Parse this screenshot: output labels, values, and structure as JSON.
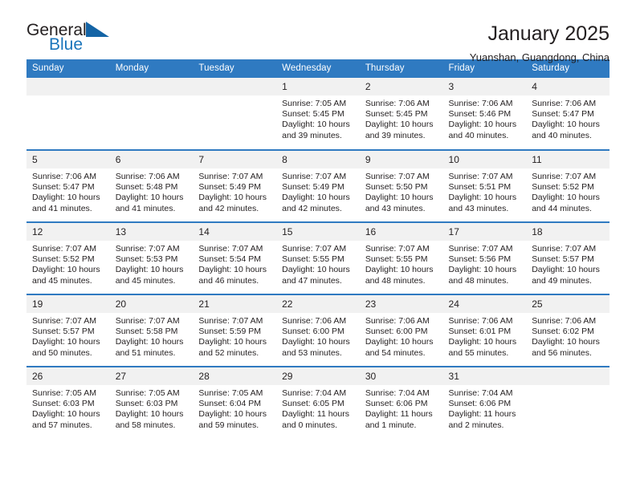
{
  "brand": {
    "name_part1": "General",
    "name_part2": "Blue",
    "triangle_icon": "triangle-icon",
    "accent_color": "#1b75bb"
  },
  "header": {
    "title": "January 2025",
    "subtitle": "Yuanshan, Guangdong, China"
  },
  "calendar": {
    "header_bg": "#2f7ac1",
    "daynum_bg": "#f1f1f1",
    "columns": [
      "Sunday",
      "Monday",
      "Tuesday",
      "Wednesday",
      "Thursday",
      "Friday",
      "Saturday"
    ],
    "weeks": [
      [
        {
          "day": "",
          "info": ""
        },
        {
          "day": "",
          "info": ""
        },
        {
          "day": "",
          "info": ""
        },
        {
          "day": "1",
          "info": "Sunrise: 7:05 AM\nSunset: 5:45 PM\nDaylight: 10 hours\nand 39 minutes."
        },
        {
          "day": "2",
          "info": "Sunrise: 7:06 AM\nSunset: 5:45 PM\nDaylight: 10 hours\nand 39 minutes."
        },
        {
          "day": "3",
          "info": "Sunrise: 7:06 AM\nSunset: 5:46 PM\nDaylight: 10 hours\nand 40 minutes."
        },
        {
          "day": "4",
          "info": "Sunrise: 7:06 AM\nSunset: 5:47 PM\nDaylight: 10 hours\nand 40 minutes."
        }
      ],
      [
        {
          "day": "5",
          "info": "Sunrise: 7:06 AM\nSunset: 5:47 PM\nDaylight: 10 hours\nand 41 minutes."
        },
        {
          "day": "6",
          "info": "Sunrise: 7:06 AM\nSunset: 5:48 PM\nDaylight: 10 hours\nand 41 minutes."
        },
        {
          "day": "7",
          "info": "Sunrise: 7:07 AM\nSunset: 5:49 PM\nDaylight: 10 hours\nand 42 minutes."
        },
        {
          "day": "8",
          "info": "Sunrise: 7:07 AM\nSunset: 5:49 PM\nDaylight: 10 hours\nand 42 minutes."
        },
        {
          "day": "9",
          "info": "Sunrise: 7:07 AM\nSunset: 5:50 PM\nDaylight: 10 hours\nand 43 minutes."
        },
        {
          "day": "10",
          "info": "Sunrise: 7:07 AM\nSunset: 5:51 PM\nDaylight: 10 hours\nand 43 minutes."
        },
        {
          "day": "11",
          "info": "Sunrise: 7:07 AM\nSunset: 5:52 PM\nDaylight: 10 hours\nand 44 minutes."
        }
      ],
      [
        {
          "day": "12",
          "info": "Sunrise: 7:07 AM\nSunset: 5:52 PM\nDaylight: 10 hours\nand 45 minutes."
        },
        {
          "day": "13",
          "info": "Sunrise: 7:07 AM\nSunset: 5:53 PM\nDaylight: 10 hours\nand 45 minutes."
        },
        {
          "day": "14",
          "info": "Sunrise: 7:07 AM\nSunset: 5:54 PM\nDaylight: 10 hours\nand 46 minutes."
        },
        {
          "day": "15",
          "info": "Sunrise: 7:07 AM\nSunset: 5:55 PM\nDaylight: 10 hours\nand 47 minutes."
        },
        {
          "day": "16",
          "info": "Sunrise: 7:07 AM\nSunset: 5:55 PM\nDaylight: 10 hours\nand 48 minutes."
        },
        {
          "day": "17",
          "info": "Sunrise: 7:07 AM\nSunset: 5:56 PM\nDaylight: 10 hours\nand 48 minutes."
        },
        {
          "day": "18",
          "info": "Sunrise: 7:07 AM\nSunset: 5:57 PM\nDaylight: 10 hours\nand 49 minutes."
        }
      ],
      [
        {
          "day": "19",
          "info": "Sunrise: 7:07 AM\nSunset: 5:57 PM\nDaylight: 10 hours\nand 50 minutes."
        },
        {
          "day": "20",
          "info": "Sunrise: 7:07 AM\nSunset: 5:58 PM\nDaylight: 10 hours\nand 51 minutes."
        },
        {
          "day": "21",
          "info": "Sunrise: 7:07 AM\nSunset: 5:59 PM\nDaylight: 10 hours\nand 52 minutes."
        },
        {
          "day": "22",
          "info": "Sunrise: 7:06 AM\nSunset: 6:00 PM\nDaylight: 10 hours\nand 53 minutes."
        },
        {
          "day": "23",
          "info": "Sunrise: 7:06 AM\nSunset: 6:00 PM\nDaylight: 10 hours\nand 54 minutes."
        },
        {
          "day": "24",
          "info": "Sunrise: 7:06 AM\nSunset: 6:01 PM\nDaylight: 10 hours\nand 55 minutes."
        },
        {
          "day": "25",
          "info": "Sunrise: 7:06 AM\nSunset: 6:02 PM\nDaylight: 10 hours\nand 56 minutes."
        }
      ],
      [
        {
          "day": "26",
          "info": "Sunrise: 7:05 AM\nSunset: 6:03 PM\nDaylight: 10 hours\nand 57 minutes."
        },
        {
          "day": "27",
          "info": "Sunrise: 7:05 AM\nSunset: 6:03 PM\nDaylight: 10 hours\nand 58 minutes."
        },
        {
          "day": "28",
          "info": "Sunrise: 7:05 AM\nSunset: 6:04 PM\nDaylight: 10 hours\nand 59 minutes."
        },
        {
          "day": "29",
          "info": "Sunrise: 7:04 AM\nSunset: 6:05 PM\nDaylight: 11 hours\nand 0 minutes."
        },
        {
          "day": "30",
          "info": "Sunrise: 7:04 AM\nSunset: 6:06 PM\nDaylight: 11 hours\nand 1 minute."
        },
        {
          "day": "31",
          "info": "Sunrise: 7:04 AM\nSunset: 6:06 PM\nDaylight: 11 hours\nand 2 minutes."
        },
        {
          "day": "",
          "info": ""
        }
      ]
    ]
  }
}
